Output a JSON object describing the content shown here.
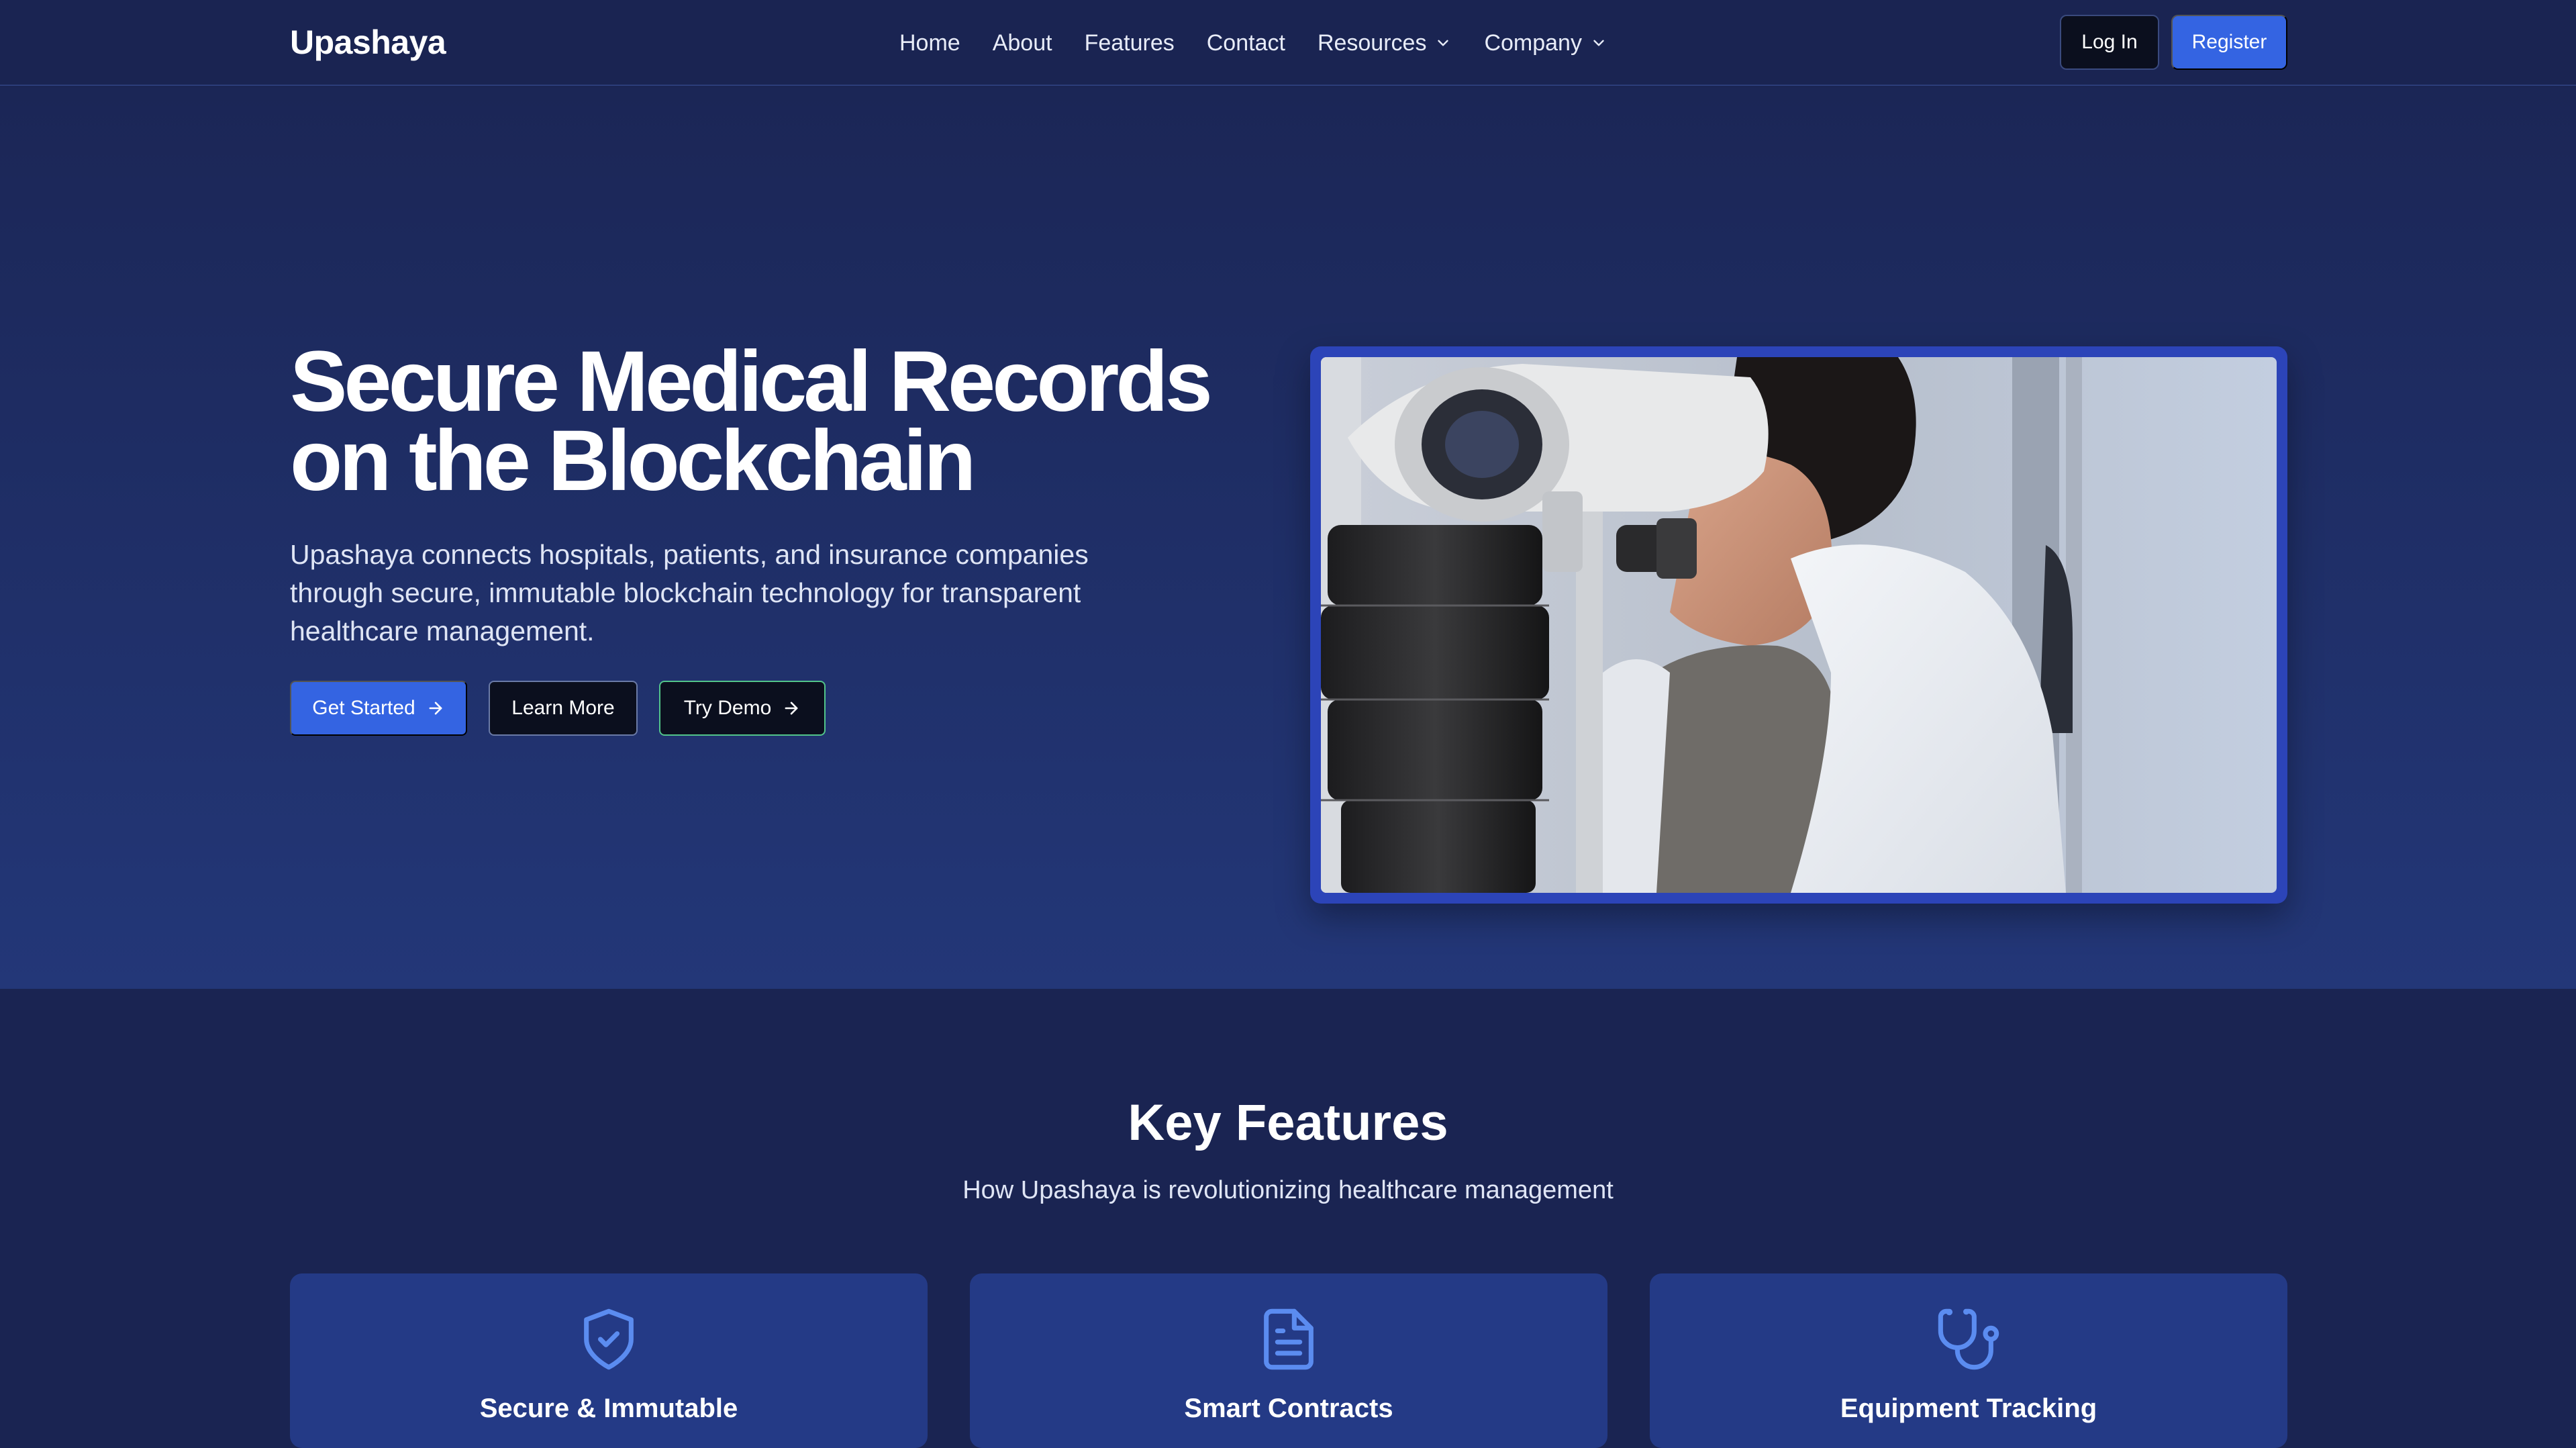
{
  "nav": {
    "brand": "Upashaya",
    "links": [
      "Home",
      "About",
      "Features",
      "Contact"
    ],
    "dropdowns": [
      "Resources",
      "Company"
    ],
    "login_label": "Log In",
    "register_label": "Register"
  },
  "hero": {
    "title": "Secure Medical Records on the Blockchain",
    "subtitle": "Upashaya connects hospitals, patients, and insurance companies through secure, immutable blockchain technology for transparent healthcare management.",
    "buttons": {
      "get_started": "Get Started",
      "learn_more": "Learn More",
      "try_demo": "Try Demo"
    },
    "image_icon": "ophthalmology-microscope-photo"
  },
  "features": {
    "title": "Key Features",
    "subtitle": "How Upashaya is revolutionizing healthcare management",
    "cards": [
      {
        "title": "Secure & Immutable",
        "icon": "shield-check-icon"
      },
      {
        "title": "Smart Contracts",
        "icon": "document-icon"
      },
      {
        "title": "Equipment Tracking",
        "icon": "stethoscope-icon"
      }
    ]
  },
  "colors": {
    "background": "#1a2452",
    "accent": "#3464e2",
    "card": "#243a86",
    "icon": "#5b8cf0",
    "demo_border": "#52c48a"
  }
}
